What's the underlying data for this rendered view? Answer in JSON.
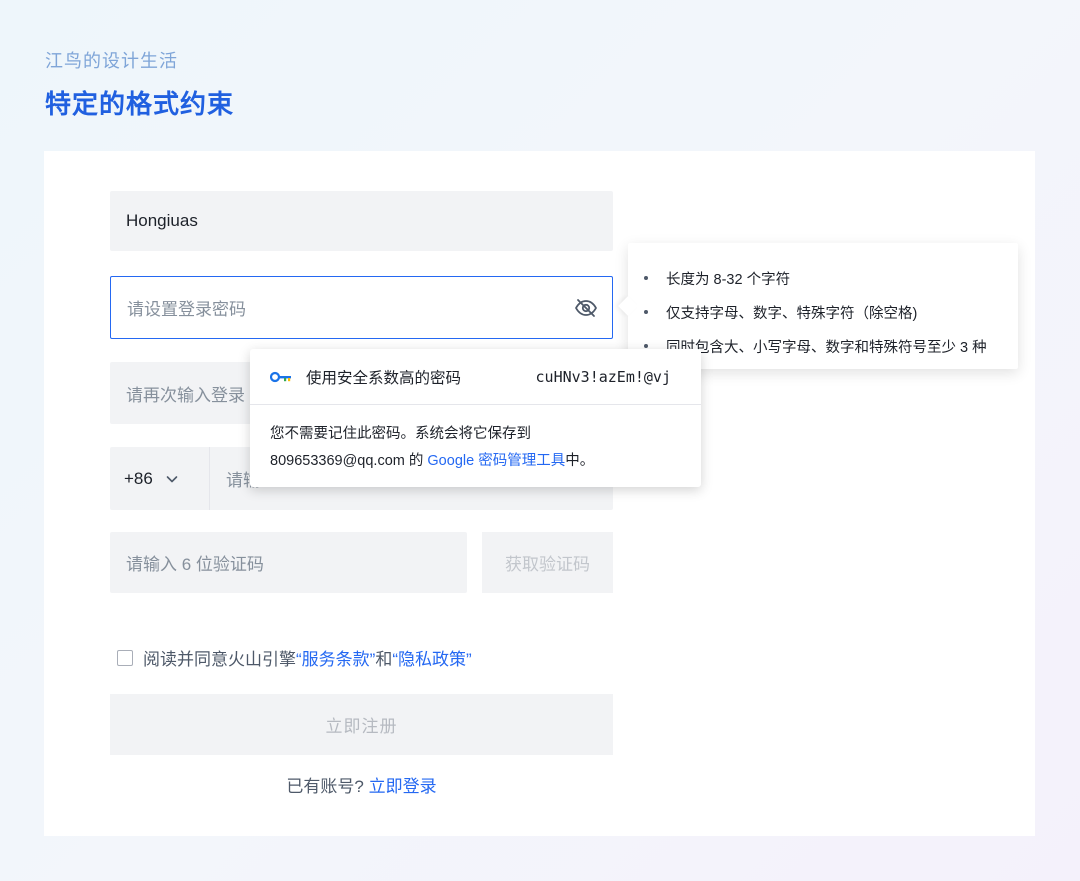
{
  "header": {
    "brand": "江鸟的设计生活",
    "title": "特定的格式约束"
  },
  "form": {
    "username_value": "Hongiuas",
    "password_placeholder": "请设置登录密码",
    "confirm_placeholder_visible": "请再次输入登录",
    "country_code": "+86",
    "phone_placeholder_visible": "请输",
    "code_placeholder": "请输入 6 位验证码",
    "get_code_label": "获取验证码",
    "agree_prefix": "阅读并同意火山引擎",
    "terms_link": "“服务条款”",
    "agree_and": "和",
    "privacy_link": "“隐私政策”",
    "register_label": "立即注册",
    "have_account": "已有账号?",
    "login_link": "立即登录"
  },
  "rules": [
    "长度为 8-32 个字符",
    "仅支持字母、数字、特殊字符（除空格)",
    "同时包含大、小写字母、数字和特殊符号至少 3 种"
  ],
  "suggestion": {
    "label": "使用安全系数高的密码",
    "password": "cuHNv3!azEm!@vj",
    "line1": "您不需要记住此密码。系统会将它保存到",
    "email": "809653369@qq.com 的 ",
    "tool_link": "Google 密码管理工具",
    "suffix": "中。"
  },
  "colors": {
    "accent": "#2468f2",
    "title": "#2060e0",
    "brand": "#7fa5d8",
    "field_bg": "#f2f3f5"
  },
  "icons": [
    "eye-off-icon",
    "chevron-down-icon",
    "key-icon",
    "checkbox-icon"
  ]
}
